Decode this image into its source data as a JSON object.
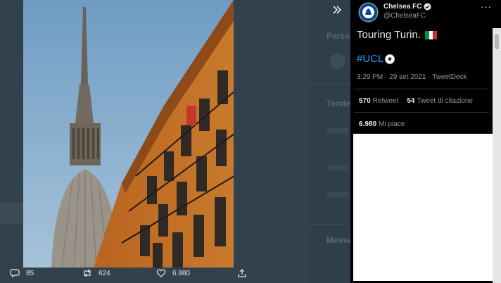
{
  "background": {
    "labels": [
      "Persone",
      "Tendenze",
      "Messaggi"
    ]
  },
  "tweet": {
    "author_name": "Chelsea FC",
    "author_handle": "@ChelseaFC",
    "text": "Touring Turin.",
    "hashtag": "#UCL",
    "meta": "3:29 PM · 29 set 2021 · TweetDeck",
    "retweets_count": "570",
    "retweets_label": "Retweet",
    "quotes_count": "54",
    "quotes_label": "Tweet di citazione",
    "likes_count": "6.980",
    "likes_label": "Mi piace"
  },
  "actions": {
    "replies": "85",
    "retweets": "624",
    "likes": "6.980"
  },
  "colors": {
    "panel_bg": "#000000",
    "text_primary": "#e7e9ea",
    "text_secondary": "#8b98a5",
    "link": "#1d9bf0",
    "avatar_blue": "#034694"
  },
  "icons": [
    "expand-icon",
    "verified-icon",
    "more-icon",
    "soccer-ball-icon",
    "reply-icon",
    "retweet-icon",
    "like-icon",
    "share-icon",
    "italy-flag-icon",
    "chelsea-crest-icon"
  ]
}
